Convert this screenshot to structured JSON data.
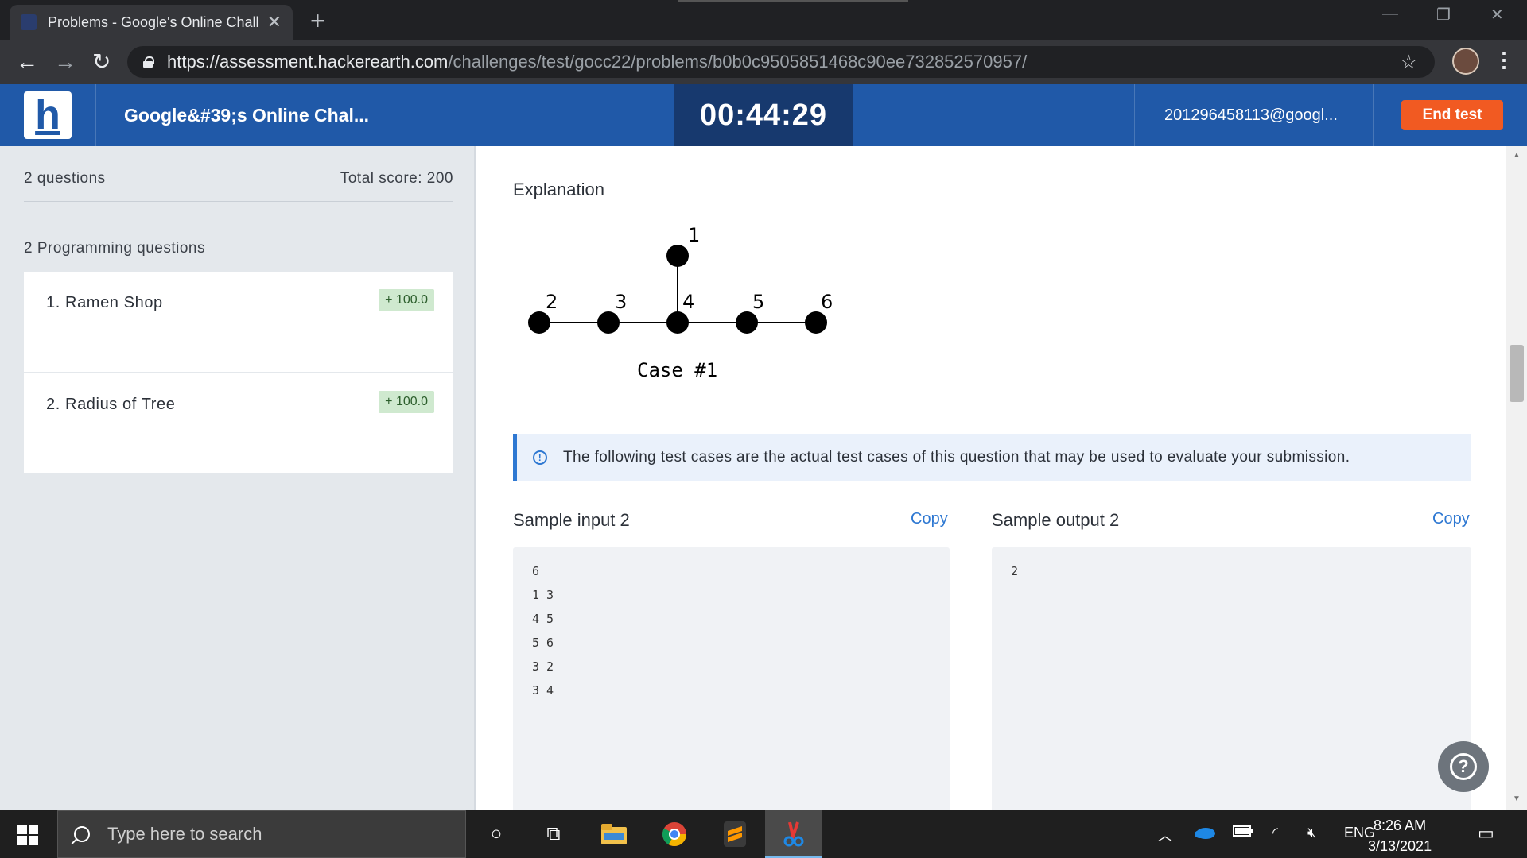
{
  "browser": {
    "tab_title": "Problems - Google's Online Chall",
    "url_host": "https://assessment.hackerearth.com",
    "url_path": "/challenges/test/gocc22/problems/b0b0c9505851468c90ee732852570957/"
  },
  "header": {
    "logo": "h",
    "title": "Google&#39;s Online Chal...",
    "timer": "00:44:29",
    "email": "201296458113@googl...",
    "end_test": "End test"
  },
  "sidebar": {
    "questions_count": "2 questions",
    "total_score": "Total score: 200",
    "section_label": "2 Programming questions",
    "questions": [
      {
        "label": "1.  Ramen Shop",
        "score": "+ 100.0"
      },
      {
        "label": "2.  Radius of Tree",
        "score": "+ 100.0"
      }
    ]
  },
  "main": {
    "explanation_heading": "Explanation",
    "diagram": {
      "nodes": [
        "1",
        "2",
        "3",
        "4",
        "5",
        "6"
      ],
      "caption": "Case  #1"
    },
    "notice": "The following test cases are the actual test cases of this question that may be used to evaluate your submission.",
    "sample_input_heading": "Sample input 2",
    "sample_output_heading": "Sample output 2",
    "copy_label": "Copy",
    "sample_input_lines": [
      "6",
      "1 3",
      "4 5",
      "5 6",
      "3 2",
      "3 4"
    ],
    "sample_output_lines": [
      "2"
    ]
  },
  "taskbar": {
    "search_placeholder": "Type here to search",
    "language": "ENG",
    "time": "8:26 AM",
    "date": "3/13/2021"
  },
  "colors": {
    "header_bg": "#2059a8",
    "timer_bg": "#17396e",
    "end_test_bg": "#f15a22",
    "link": "#2e78d2",
    "badge_bg": "#cfe9cf"
  }
}
